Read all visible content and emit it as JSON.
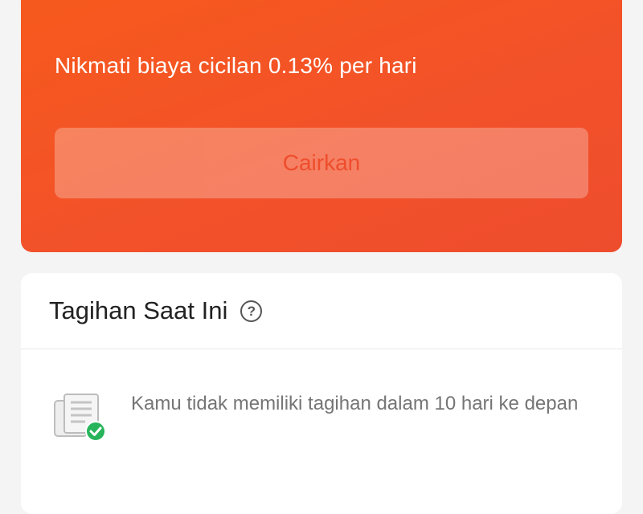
{
  "promo": {
    "subtitle": "Nikmati biaya cicilan 0.13% per hari",
    "button_label": "Cairkan",
    "background_color": "#f75a1c",
    "button_text_color": "#ee4d2d"
  },
  "bills": {
    "title": "Tagihan Saat Ini",
    "help_icon": "question-circle-icon",
    "help_glyph": "?",
    "empty_icon": "document-check-icon",
    "empty_message": "Kamu tidak memiliki tagihan dalam 10 hari ke depan",
    "check_color": "#27b45b"
  }
}
